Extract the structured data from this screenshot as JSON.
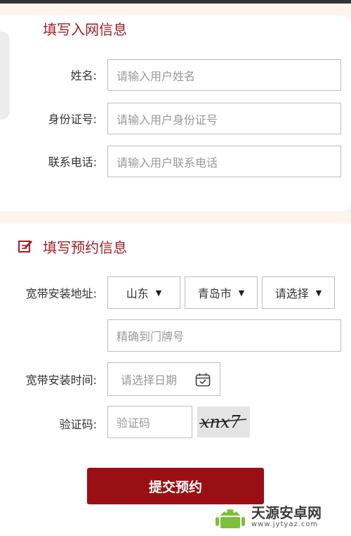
{
  "user_section": {
    "title": "填写入网信息",
    "fields": [
      {
        "label": "姓名:",
        "placeholder": "请输入用户姓名"
      },
      {
        "label": "身份证号:",
        "placeholder": "请输入用户身份证号"
      },
      {
        "label": "联系电话:",
        "placeholder": "请输入用户联系电话"
      }
    ]
  },
  "booking_section": {
    "title": "填写预约信息",
    "address_label": "宽带安装地址:",
    "province": "山东",
    "city": "青岛市",
    "district": "请选择",
    "address_detail_placeholder": "精确到门牌号",
    "time_label": "宽带安装时间:",
    "date_placeholder": "请选择日期",
    "captcha_label": "验证码:",
    "captcha_placeholder": "验证码",
    "captcha_text": "xnx7",
    "submit_label": "提交预约"
  },
  "watermark": {
    "name": "天源安卓网",
    "url": "www.jytyaz.com"
  },
  "colors": {
    "accent": "#a01f24",
    "button": "#9a0f13",
    "background": "#fdf4ee"
  }
}
